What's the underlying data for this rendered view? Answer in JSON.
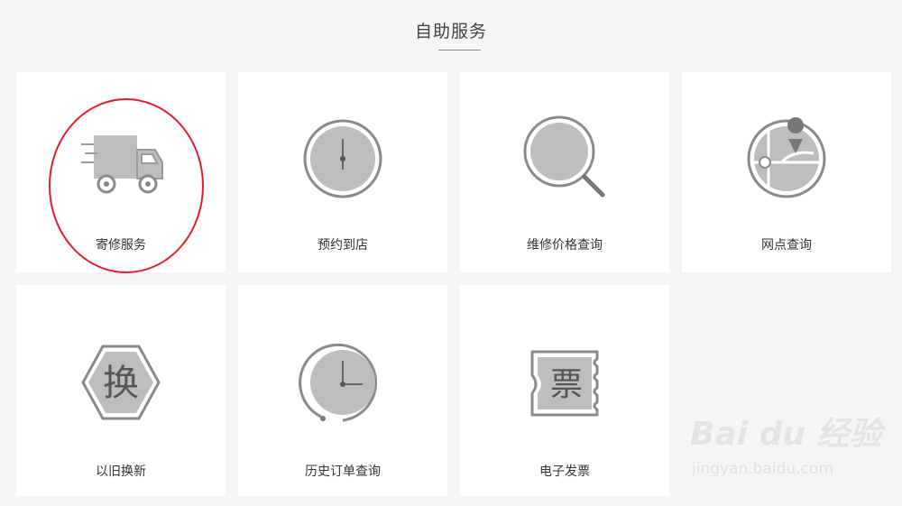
{
  "section": {
    "title": "自助服务"
  },
  "services": [
    {
      "label": "寄修服务",
      "icon": "delivery-truck-icon"
    },
    {
      "label": "预约到店",
      "icon": "clock-icon"
    },
    {
      "label": "维修价格查询",
      "icon": "magnifier-icon"
    },
    {
      "label": "网点查询",
      "icon": "map-pin-icon"
    },
    {
      "label": "以旧换新",
      "icon": "exchange-icon",
      "icon_text": "换"
    },
    {
      "label": "历史订单查询",
      "icon": "history-clock-icon"
    },
    {
      "label": "电子发票",
      "icon": "ticket-icon",
      "icon_text": "票"
    }
  ],
  "annotation": {
    "color": "#e11d2a",
    "target": "寄修服务"
  },
  "watermark": {
    "brand": "Bai du 经验",
    "url": "jingyan.baidu.com"
  },
  "colors": {
    "background": "#f5f5f5",
    "card": "#ffffff",
    "icon_fill": "#bdbdbd",
    "icon_stroke": "#8a8a8a"
  }
}
